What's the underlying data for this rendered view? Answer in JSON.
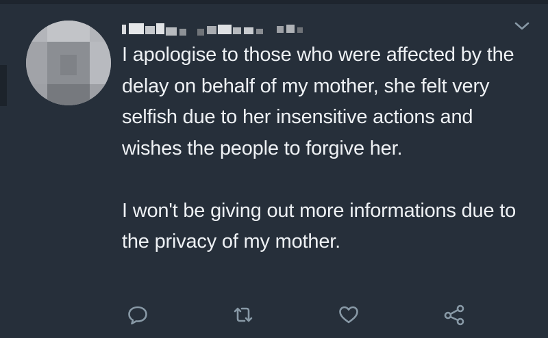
{
  "tweet": {
    "paragraphs": [
      "I apologise to those who were affected by the delay on behalf of my mother, she felt very selfish due to her insensitive actions and wishes the people to forgive her.",
      "I won't be giving out more informations due to the privacy of my mother."
    ],
    "avatar_state": "pixelated",
    "username_state": "pixelated"
  },
  "icons": {
    "menu": "chevron-down-icon",
    "reply": "reply-icon",
    "retweet": "retweet-icon",
    "like": "heart-icon",
    "share": "share-icon"
  },
  "colors": {
    "background": "#262f3a",
    "text": "#eef1f4",
    "icon": "#8899a6"
  }
}
